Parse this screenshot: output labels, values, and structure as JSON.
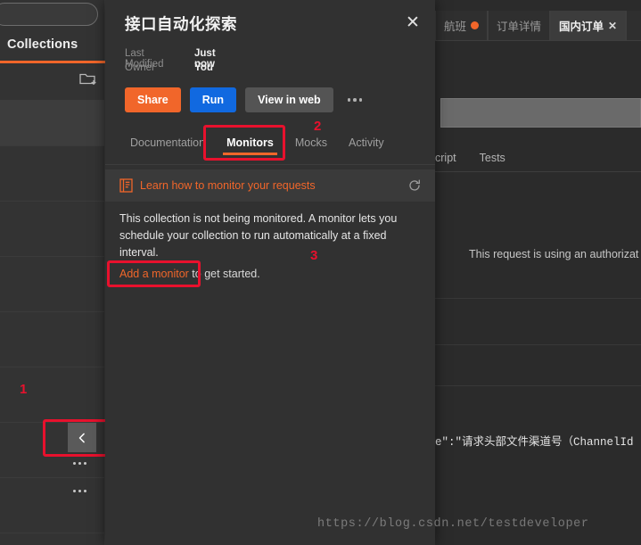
{
  "sidebar": {
    "search_placeholder": "",
    "tab_label": "Collections",
    "newfolder_icon": "new-folder-icon",
    "annotation_1": "1",
    "collapse_icon": "chevron-left-icon",
    "rows": [
      {
        "label": ""
      },
      {
        "label": ""
      },
      {
        "label": ""
      },
      {
        "label": ""
      },
      {
        "label": ""
      },
      {
        "label": ""
      }
    ]
  },
  "background_app": {
    "tabs": [
      {
        "label": "航班",
        "has_dot": true,
        "active": false,
        "closable": false
      },
      {
        "label": "订单详情",
        "has_dot": false,
        "active": false,
        "closable": false
      },
      {
        "label": "国内订单",
        "has_dot": false,
        "active": true,
        "closable": true,
        "close_label": "✕"
      }
    ],
    "sub_tabs": [
      "cript",
      "Tests"
    ],
    "auth_note": "This request is using an authorizat",
    "code_line": "e\":\"请求头部文件渠道号（ChannelId"
  },
  "modal": {
    "title": "接口自动化探索",
    "close_label": "✕",
    "meta": [
      {
        "label": "Last Modified",
        "value": "Just now"
      },
      {
        "label": "Owner",
        "value": "You"
      }
    ],
    "buttons": {
      "share": "Share",
      "run": "Run",
      "view_in_web": "View in web",
      "more_icon": "ellipsis-icon"
    },
    "tabs": [
      {
        "label": "Documentation",
        "active": false
      },
      {
        "label": "Monitors",
        "active": true
      },
      {
        "label": "Mocks",
        "active": false
      },
      {
        "label": "Activity",
        "active": false
      }
    ],
    "learn_banner": {
      "icon": "book-icon",
      "link_text": "Learn how to monitor your requests",
      "refresh_icon": "refresh-icon"
    },
    "empty_state": {
      "paragraph": "This collection is not being monitored. A monitor lets you schedule your collection to run automatically at a fixed interval.",
      "cta_link": "Add a monitor",
      "cta_rest": " to get started."
    },
    "annotation_2": "2",
    "annotation_3": "3"
  },
  "watermark": "https://blog.csdn.net/testdeveloper",
  "colors": {
    "accent_orange": "#f1662a",
    "run_blue": "#1169e0",
    "annotation_red": "#e8112d",
    "modal_bg": "#313131",
    "page_bg": "#2b2b2b"
  }
}
